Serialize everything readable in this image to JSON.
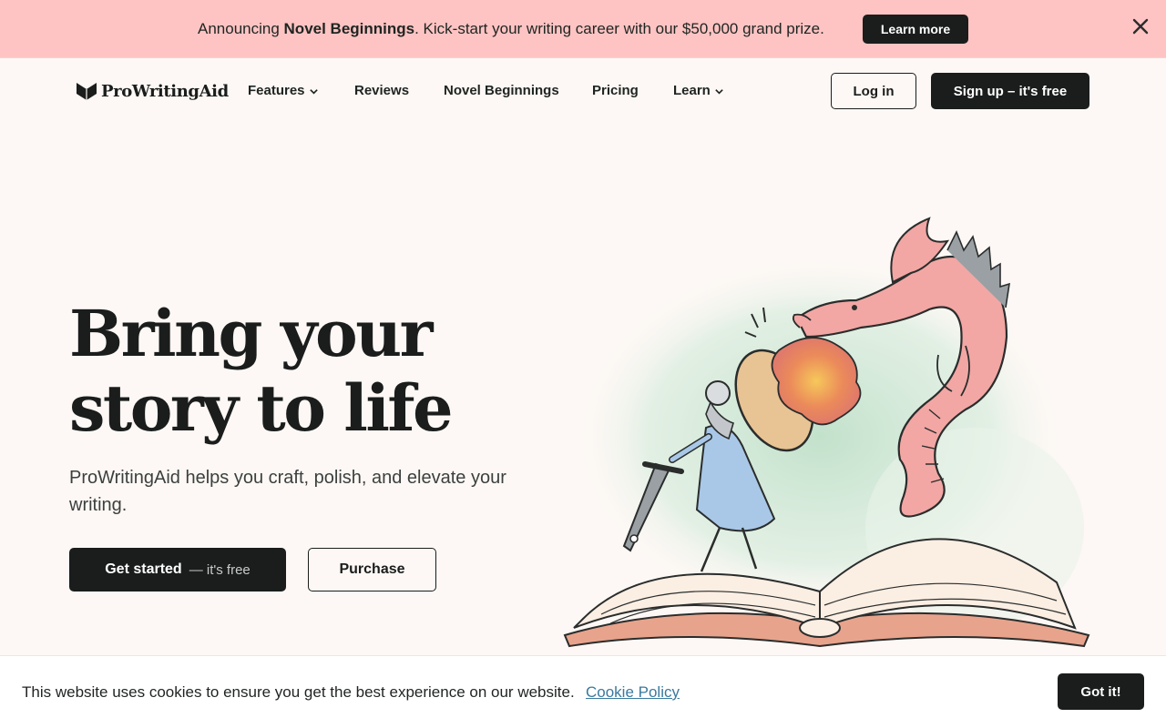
{
  "banner": {
    "prefix": "Announcing ",
    "highlight": "Novel Beginnings",
    "suffix": ". Kick-start your writing career with our $50,000 grand prize.",
    "button_label": "Learn more",
    "close_icon": "close-icon",
    "background_color": "#fdc4c3"
  },
  "nav": {
    "logo_text": "ProWritingAid",
    "logo_icon": "book-icon",
    "items": [
      {
        "label": "Features",
        "has_dropdown": true
      },
      {
        "label": "Reviews",
        "has_dropdown": false
      },
      {
        "label": "Novel Beginnings",
        "has_dropdown": false
      },
      {
        "label": "Pricing",
        "has_dropdown": false
      },
      {
        "label": "Learn",
        "has_dropdown": true
      }
    ],
    "login_label": "Log in",
    "signup_label": "Sign up – it's free"
  },
  "hero": {
    "title_line1": "Bring your",
    "title_line2": "story to life",
    "subtitle": "ProWritingAid helps you craft, polish, and elevate your writing.",
    "cta_primary": "Get started",
    "cta_primary_suffix": "— it's free",
    "cta_secondary": "Purchase"
  },
  "cookie": {
    "message": "This website uses cookies to ensure you get the best experience on our website.",
    "link_label": "Cookie Policy",
    "accept_label": "Got it!"
  },
  "colors": {
    "dark": "#1a1d1c",
    "page_background": "#fdf8f5",
    "link": "#3a7a9e",
    "dragon": "#f2a7a4",
    "knight_dress": "#a9c8e8",
    "splash": "#cfe6d6"
  }
}
